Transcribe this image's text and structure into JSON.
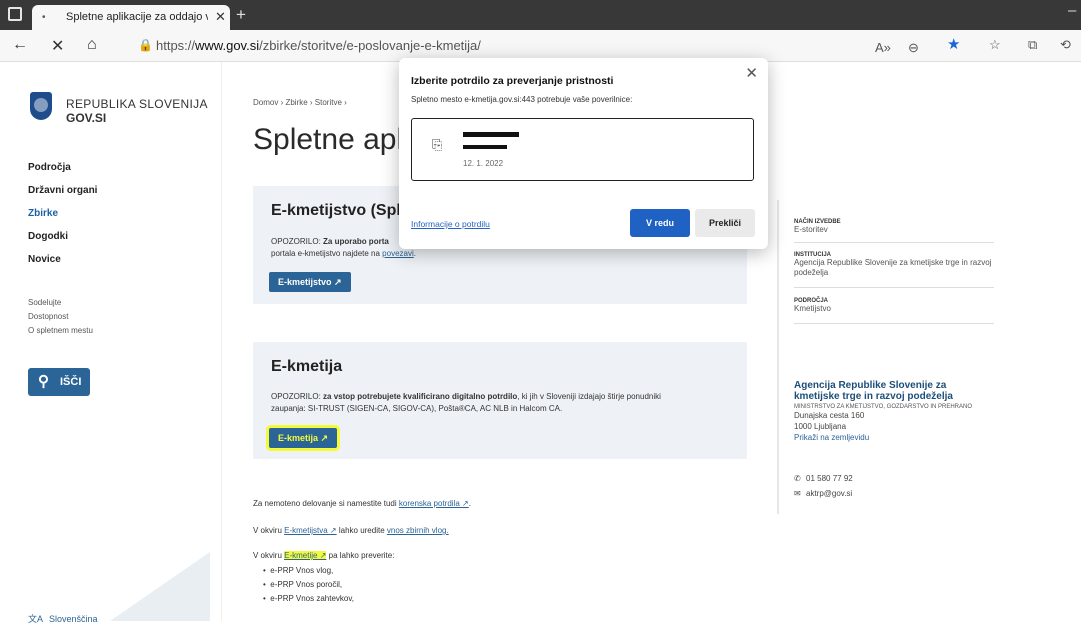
{
  "browser": {
    "tab_title": "Spletne aplikacije za oddajo vlog",
    "url_prefix": "https://",
    "url_domain": "www.gov.si",
    "url_path": "/zbirke/storitve/e-poslovanje-e-kmetija/"
  },
  "sidebar": {
    "logo_line1": "REPUBLIKA SLOVENIJA",
    "logo_line2": "GOV.SI",
    "nav": [
      "Področja",
      "Državni organi",
      "Zbirke",
      "Dogodki",
      "Novice"
    ],
    "footer": [
      "Sodelujte",
      "Dostopnost",
      "O spletnem mestu"
    ],
    "search_label": "IŠČI",
    "language": "Slovenščina"
  },
  "main": {
    "breadcrumb": "Domov  ›  Zbirke  ›  Storitve  ›",
    "title": "Spletne aplik",
    "card1": {
      "title": "E-kmetijstvo (Sple",
      "warn_prefix": "OPOZORILO:",
      "warn_bold": "Za uporabo porta",
      "text2_pre": "portala e-kmetijstvo najdete na ",
      "text2_link": "povezavi",
      "text2_post": ".",
      "button": "E-kmetijstvo ↗"
    },
    "card2": {
      "title": "E-kmetija",
      "warn_prefix": "OPOZORILO:",
      "warn_bold": "za vstop potrebujete kvalificirano digitalno potrdilo",
      "warn_rest": ", ki jih v Sloveniji izdajajo štirje ponudniki",
      "text2": "zaupanja: SI-TRUST (SIGEN-CA, SIGOV-CA), Pošta®CA, AC NLB in Halcom CA.",
      "button": "E-kmetija ↗"
    },
    "para1_pre": "Za nemoteno delovanje si namestite tudi ",
    "para1_link": "korenska potrdila ↗",
    "para1_post": ".",
    "para2_pre": "V okviru ",
    "para2_link1": "E-kmetijstva ↗",
    "para2_mid": " lahko uredite ",
    "para2_link2": "vnos zbirnih vlog.",
    "para3_pre": "V okviru ",
    "para3_link": "E-kmetije ↗",
    "para3_post": " pa lahko preverite:",
    "bullets": [
      "e-PRP Vnos vlog,",
      "e-PRP Vnos poročil,",
      "e-PRP Vnos zahtevkov,"
    ]
  },
  "info": {
    "nacin_key": "NAČIN IZVEDBE",
    "nacin_val": "E-storitev",
    "inst_key": "INSTITUCIJA",
    "inst_val": "Agencija Republike Slovenije za kmetijske trge in razvoj podeželja",
    "podrocja_key": "PODROČJA",
    "podrocja_val": "Kmetijstvo",
    "agency_name": "Agencija Republike Slovenije za kmetijske trge in razvoj podeželja",
    "ministry": "MINISTRSTVO ZA KMETIJSTVO, GOZDARSTVO IN PREHRANO",
    "street": "Dunajska cesta 160",
    "city": "1000 Ljubljana",
    "map_link": "Prikaži na zemljevidu",
    "phone": "01 580 77 92",
    "email": "aktrp@gov.si"
  },
  "dialog": {
    "title": "Izberite potrdilo za preverjanje pristnosti",
    "subtitle": "Spletno mesto e-kmetija.gov.si:443 potrebuje vaše poverilnice:",
    "cert_date": "12. 1. 2022",
    "info_link": "Informacije o potrdilu",
    "ok": "V redu",
    "cancel": "Prekliči"
  },
  "colors": {
    "primary_button": "#2b6496",
    "dialog_ok": "#1f62c4",
    "highlight": "#f4fa3a"
  }
}
